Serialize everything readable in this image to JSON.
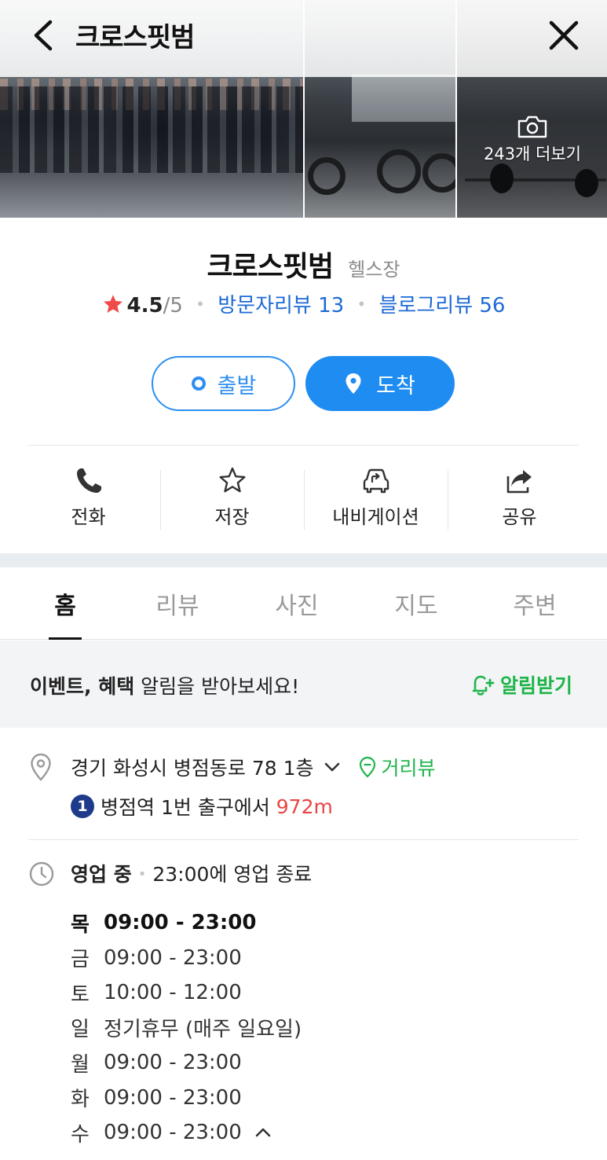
{
  "header": {
    "title": "크로스핏범"
  },
  "gallery": {
    "more_label": "243개 더보기"
  },
  "place": {
    "name": "크로스핏범",
    "category": "헬스장",
    "rating_value": "4.5",
    "rating_max": "/5",
    "visitor_reviews": "방문자리뷰 13",
    "blog_reviews": "블로그리뷰 56"
  },
  "route": {
    "start_label": "출발",
    "arrive_label": "도착"
  },
  "actions": [
    {
      "label": "전화",
      "icon": "phone-icon"
    },
    {
      "label": "저장",
      "icon": "star-outline-icon"
    },
    {
      "label": "내비게이션",
      "icon": "car-navigation-icon"
    },
    {
      "label": "공유",
      "icon": "share-icon"
    }
  ],
  "tabs": [
    {
      "label": "홈",
      "active": true
    },
    {
      "label": "리뷰"
    },
    {
      "label": "사진"
    },
    {
      "label": "지도"
    },
    {
      "label": "주변"
    }
  ],
  "event": {
    "bold_text": "이벤트, 혜택",
    "text": " 알림을 받아보세요!",
    "button_label": "알림받기"
  },
  "address": {
    "text": "경기 화성시 병점동로 78 1층",
    "streetview_label": "거리뷰",
    "line_number": "1",
    "station": "병점역",
    "exit_text": " 1번 출구에서 ",
    "distance": "972m"
  },
  "hours": {
    "status": "영업 중",
    "close_text": "23:00에 영업 종료",
    "rows": [
      {
        "day": "목",
        "time": "09:00 - 23:00",
        "today": true
      },
      {
        "day": "금",
        "time": "09:00 - 23:00"
      },
      {
        "day": "토",
        "time": "10:00 - 12:00"
      },
      {
        "day": "일",
        "time": "정기휴무 (매주 일요일)"
      },
      {
        "day": "월",
        "time": "09:00 - 23:00"
      },
      {
        "day": "화",
        "time": "09:00 - 23:00"
      },
      {
        "day": "수",
        "time": "09:00 - 23:00"
      }
    ]
  },
  "colors": {
    "accent_blue": "#1f8cf2",
    "link_blue": "#1e6ad6",
    "green": "#1fb54a",
    "distance_red": "#e84545",
    "star_red": "#f04b4b",
    "line1_navy": "#1e3a8a"
  }
}
